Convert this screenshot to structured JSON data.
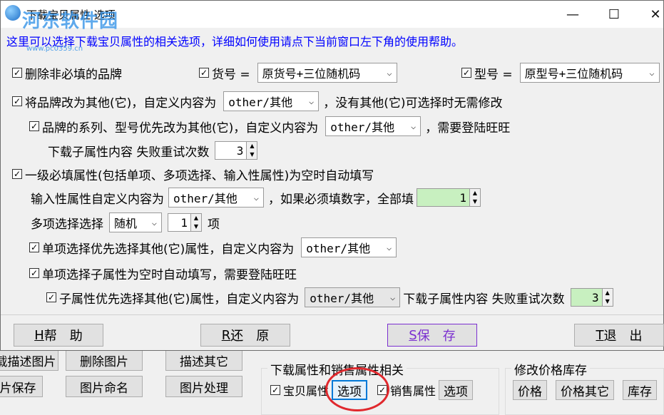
{
  "window": {
    "title": "下载宝贝属性 选项",
    "watermark": "河东软件园",
    "watermark_url": "www.pc0359.cn",
    "minimize": "—",
    "maximize": "☐",
    "close": "✕"
  },
  "info_text": "这里可以选择下载宝贝属性的相关选项，详细如何使用请点下当前窗口左下角的使用帮助。",
  "options": {
    "delete_brand": {
      "label": "删除非必填的品牌",
      "checked": true
    },
    "item_no": {
      "label": "货号 =",
      "checked": true,
      "value": "原货号+三位随机码"
    },
    "model_no": {
      "label": "型号 =",
      "checked": true,
      "value": "原型号+三位随机码"
    },
    "brand_other": {
      "label": "将品牌改为其他(它)，自定义内容为",
      "checked": true,
      "value": "other/其他",
      "suffix": "，没有其他(它)可选择时无需修改"
    },
    "series_other": {
      "label": "品牌的系列、型号优先改为其他(它)，自定义内容为",
      "checked": true,
      "value": "other/其他",
      "suffix": "，需要登陆旺旺"
    },
    "sub_retry": {
      "label": "下载子属性内容 失败重试次数",
      "value": "3"
    },
    "auto_fill": {
      "label": "一级必填属性(包括单项、多项选择、输入性属性)为空时自动填写",
      "checked": true
    },
    "input_custom": {
      "label": "输入性属性自定义内容为",
      "value": "other/其他",
      "suffix": "，如果必须填数字，全部填",
      "number": "1"
    },
    "multi_select": {
      "label": "多项选择选择",
      "mode": "随机",
      "count": "1",
      "unit": "项"
    },
    "single_other": {
      "label": "单项选择优先选择其他(它)属性，自定义内容为",
      "checked": true,
      "value": "other/其他"
    },
    "single_sub_fill": {
      "label": "单项选择子属性为空时自动填写，需要登陆旺旺",
      "checked": true
    },
    "sub_prop_other": {
      "label": "子属性优先选择其他(它)属性，自定义内容为",
      "checked": true,
      "value": "other/其他",
      "suffix": "下载子属性内容 失败重试次数",
      "retry": "3"
    }
  },
  "footer": {
    "help": {
      "key": "H",
      "label": "帮　助"
    },
    "restore": {
      "key": "R",
      "label": "还　原"
    },
    "save": {
      "key": "S",
      "label": "保　存"
    },
    "exit": {
      "key": "T",
      "label": "退　出"
    }
  },
  "background": {
    "buttons_row1": [
      "载描述图片",
      "删除图片",
      "描述其它"
    ],
    "buttons_row2": [
      "片保存",
      "图片命名",
      "图片处理"
    ],
    "group1": {
      "title": "下载属性和销售属性相关",
      "item_props": "宝贝属性",
      "options1": "选项",
      "sale_props": "销售属性",
      "options2": "选项"
    },
    "group2": {
      "title": "修改价格库存",
      "price": "价格",
      "price_other": "价格其它",
      "stock": "库存"
    }
  }
}
